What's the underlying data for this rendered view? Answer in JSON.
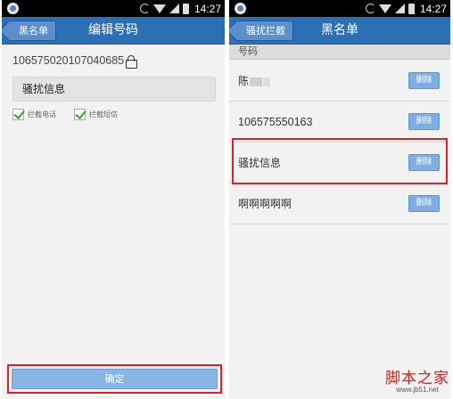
{
  "status_bar": {
    "time": "14:27"
  },
  "left_screen": {
    "back_label": "黑名单",
    "title": "编辑号码",
    "number": "106575020107040685",
    "name_value": "骚扰信息",
    "checkbox_call": {
      "label": "拦截电话",
      "checked": true
    },
    "checkbox_sms": {
      "label": "拦截短信",
      "checked": true
    },
    "confirm_label": "确定"
  },
  "right_screen": {
    "back_label": "骚扰拦截",
    "title": "黑名单",
    "section_header": "号码",
    "delete_label": "删除",
    "rows": [
      {
        "label": "陈"
      },
      {
        "label": "106575550163"
      },
      {
        "label": "骚扰信息",
        "highlighted": true
      },
      {
        "label": "啊啊啊啊啊"
      }
    ]
  },
  "watermark": {
    "main": "脚本之家",
    "sub": "www.jb51.net"
  },
  "colors": {
    "accent": "#2d6fb5",
    "highlight": "#e0202a",
    "button": "#7eaee3"
  }
}
